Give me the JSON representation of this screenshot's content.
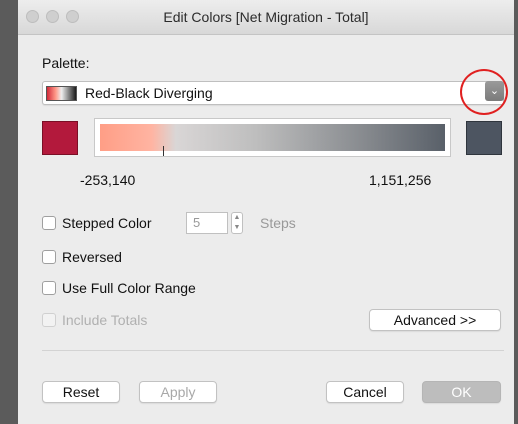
{
  "window": {
    "title": "Edit Colors [Net Migration - Total]"
  },
  "palette": {
    "label": "Palette:",
    "selected": "Red-Black Diverging",
    "dropdown_icon": "chevron-down-icon",
    "start_color": "#b3193c",
    "end_color": "#4d5561",
    "min_value": "-253,140",
    "max_value": "1,151,256"
  },
  "options": {
    "stepped_color": {
      "label": "Stepped Color",
      "checked": false
    },
    "steps_value": "5",
    "steps_label": "Steps",
    "reversed": {
      "label": "Reversed",
      "checked": false
    },
    "use_full_range": {
      "label": "Use Full Color Range",
      "checked": false
    },
    "include_totals": {
      "label": "Include Totals",
      "checked": false,
      "disabled": true
    }
  },
  "buttons": {
    "advanced": "Advanced >>",
    "reset": "Reset",
    "apply": "Apply",
    "cancel": "Cancel",
    "ok": "OK"
  },
  "icons": {
    "stepper": "stepper-arrows-icon"
  }
}
